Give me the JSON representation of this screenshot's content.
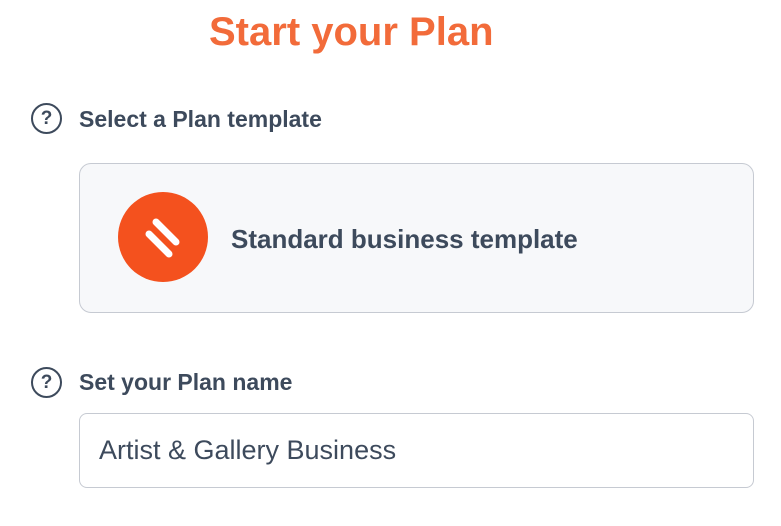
{
  "header": {
    "title": "Start your Plan"
  },
  "template_section": {
    "help_icon": "question-circle-icon",
    "help_glyph": "?",
    "label": "Select a Plan template",
    "selected_template": {
      "logo_icon": "brand-stripes-icon",
      "name": "Standard business template"
    }
  },
  "name_section": {
    "help_icon": "question-circle-icon",
    "help_glyph": "?",
    "label": "Set your Plan name",
    "input_value": "Artist & Gallery Business"
  },
  "colors": {
    "accent": "#f26b3a",
    "logo": "#f4511e",
    "text": "#3d4a5c",
    "border": "#c6cad2",
    "card_bg": "#f7f8fa"
  }
}
